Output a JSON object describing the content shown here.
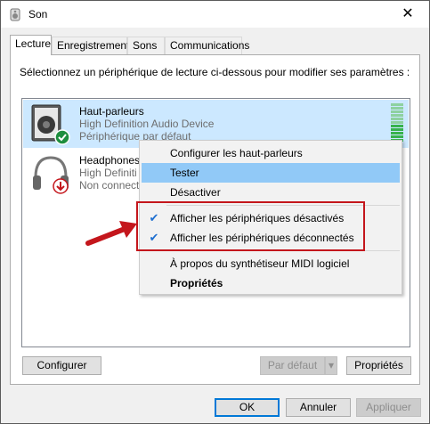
{
  "window": {
    "title": "Son",
    "close_glyph": "✕"
  },
  "tabs": [
    {
      "label": "Lecture"
    },
    {
      "label": "Enregistrement"
    },
    {
      "label": "Sons"
    },
    {
      "label": "Communications"
    }
  ],
  "instruction": "Sélectionnez un périphérique de lecture ci-dessous pour modifier ses paramètres :",
  "devices": [
    {
      "name": "Haut-parleurs",
      "line1": "High Definition Audio Device",
      "line2": "Périphérique par défaut",
      "icon": "speaker-icon",
      "status_icon": "default-check-icon"
    },
    {
      "name": "Headphones",
      "line1": "High Definiti",
      "line2": "Non connect",
      "icon": "headphones-icon",
      "status_icon": "disconnected-arrow-icon"
    }
  ],
  "context_menu": {
    "items": [
      {
        "label": "Configurer les haut-parleurs"
      },
      {
        "label": "Tester"
      },
      {
        "label": "Désactiver"
      },
      {
        "label": "Afficher les périphériques désactivés",
        "check": "✔"
      },
      {
        "label": "Afficher les périphériques déconnectés",
        "check": "✔"
      },
      {
        "label": "À propos du synthétiseur MIDI logiciel"
      },
      {
        "label": "Propriétés"
      }
    ]
  },
  "buttons": {
    "configurer": "Configurer",
    "par_defaut": "Par défaut",
    "dropdown_glyph": "▾",
    "proprietes": "Propriétés",
    "ok": "OK",
    "annuler": "Annuler",
    "appliquer": "Appliquer"
  },
  "colors": {
    "selection": "#cce8ff",
    "menu_highlight": "#91c9f7",
    "annotation": "#c4161c",
    "accent": "#0078d7"
  }
}
